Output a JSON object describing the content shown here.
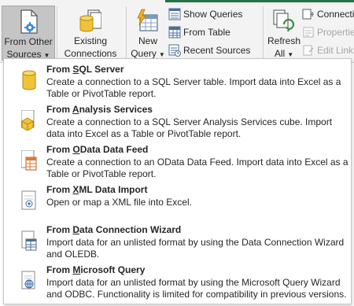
{
  "ribbon": {
    "from_other_sources": {
      "line1": "From Other",
      "line2": "Sources",
      "icon": "document-gear-icon",
      "pressed": true
    },
    "existing_connections": {
      "line1": "Existing",
      "line2": "Connections",
      "icon": "database-documents-icon"
    },
    "new_query": {
      "line1": "New",
      "line2": "Query",
      "icon": "table-lightning-icon"
    },
    "show_queries": {
      "label": "Show Queries",
      "icon": "query-list-icon"
    },
    "from_table": {
      "label": "From Table",
      "icon": "table-grid-icon"
    },
    "recent_sources": {
      "label": "Recent Sources",
      "icon": "recent-clock-icon"
    },
    "refresh_all": {
      "line1": "Refresh",
      "line2": "All",
      "icon": "refresh-icon"
    },
    "connections": {
      "label": "Connectio",
      "icon": "connections-icon"
    },
    "properties": {
      "label": "Propertie",
      "icon": "properties-icon",
      "disabled": true
    },
    "edit_links": {
      "label": "Edit Links",
      "icon": "edit-links-icon",
      "disabled": true
    },
    "colors": {
      "accent": "#217346",
      "pressed_bg": "#c5c5c5"
    }
  },
  "menu": {
    "items": [
      {
        "title_pre": "From ",
        "title_u": "S",
        "title_post": "QL Server",
        "description": "Create a connection to a SQL Server table. Import data into Excel as a Table or PivotTable report.",
        "icon": "sql-server-database-icon"
      },
      {
        "title_pre": "From ",
        "title_u": "A",
        "title_post": "nalysis Services",
        "description": "Create a connection to a SQL Server Analysis Services cube. Import data into Excel as a Table or PivotTable report.",
        "icon": "analysis-services-cube-icon"
      },
      {
        "title_pre": "From ",
        "title_u": "O",
        "title_post": "Data Data Feed",
        "description": "Create a connection to an OData Data Feed. Import data into Excel as a Table or PivotTable report.",
        "icon": "odata-feed-icon"
      },
      {
        "title_pre": "From ",
        "title_u": "X",
        "title_post": "ML Data Import",
        "description": "Open or map a XML file into Excel.",
        "icon": "xml-file-icon"
      },
      {
        "title_pre": "From ",
        "title_u": "D",
        "title_post": "ata Connection Wizard",
        "description": "Import data for an unlisted format by using the Data Connection Wizard and OLEDB.",
        "icon": "data-connection-wizard-icon"
      },
      {
        "title_pre": "From ",
        "title_u": "M",
        "title_post": "icrosoft Query",
        "description": "Import data for an unlisted format by using the Microsoft Query Wizard and ODBC. Functionality is limited for compatibility in previous versions.",
        "icon": "microsoft-query-icon"
      }
    ]
  }
}
